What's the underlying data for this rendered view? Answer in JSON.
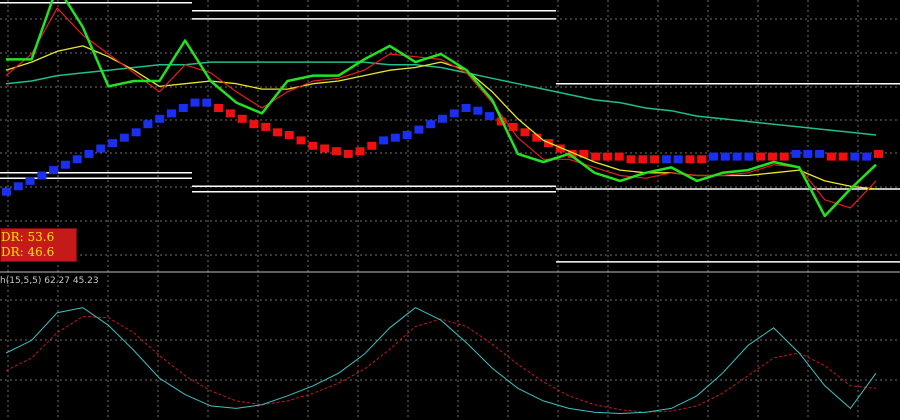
{
  "indicator_label": "h(15,5,5) 62.27 45.23",
  "dr_box": {
    "line1": "DR: 53.6",
    "line2": "DR: 46.6"
  },
  "colors": {
    "background": "#000000",
    "grid": "#6f6f6f",
    "fast_line": "#22e322",
    "signal_line": "#e51d1d",
    "ma_line": "#e8e829",
    "trend_line": "#1fbf88",
    "block_up": "#1a2ff2",
    "block_down": "#f20f0f",
    "level_line": "#ffffff",
    "osc_main": "#3ec2c2",
    "osc_signal": "#c41a1a",
    "separator": "#c0c0c0"
  },
  "chart_data": [
    {
      "type": "line",
      "panel": "price",
      "x_points": 35,
      "ylim": [
        0,
        1
      ],
      "series": [
        {
          "role": "fast",
          "values": [
            0.78,
            0.78,
            1.05,
            0.9,
            0.68,
            0.7,
            0.7,
            0.85,
            0.7,
            0.62,
            0.58,
            0.7,
            0.72,
            0.72,
            0.78,
            0.83,
            0.77,
            0.8,
            0.74,
            0.63,
            0.43,
            0.4,
            0.43,
            0.36,
            0.33,
            0.36,
            0.38,
            0.33,
            0.36,
            0.37,
            0.4,
            0.38,
            0.2,
            0.3,
            0.39
          ]
        },
        {
          "role": "signal",
          "values": [
            0.72,
            0.8,
            0.97,
            0.87,
            0.8,
            0.73,
            0.66,
            0.76,
            0.73,
            0.66,
            0.6,
            0.66,
            0.7,
            0.71,
            0.74,
            0.8,
            0.79,
            0.78,
            0.73,
            0.62,
            0.49,
            0.41,
            0.41,
            0.38,
            0.35,
            0.34,
            0.36,
            0.35,
            0.35,
            0.36,
            0.39,
            0.38,
            0.26,
            0.23,
            0.33
          ]
        },
        {
          "role": "ma",
          "values": [
            0.74,
            0.77,
            0.81,
            0.83,
            0.79,
            0.74,
            0.68,
            0.69,
            0.7,
            0.69,
            0.67,
            0.67,
            0.69,
            0.7,
            0.72,
            0.74,
            0.75,
            0.77,
            0.74,
            0.66,
            0.56,
            0.48,
            0.44,
            0.4,
            0.37,
            0.36,
            0.36,
            0.35,
            0.35,
            0.35,
            0.36,
            0.37,
            0.33,
            0.31,
            0.3
          ]
        },
        {
          "role": "trend",
          "values": [
            0.69,
            0.7,
            0.72,
            0.73,
            0.74,
            0.75,
            0.76,
            0.76,
            0.77,
            0.77,
            0.77,
            0.77,
            0.77,
            0.77,
            0.77,
            0.76,
            0.76,
            0.75,
            0.73,
            0.71,
            0.69,
            0.67,
            0.65,
            0.63,
            0.62,
            0.6,
            0.59,
            0.57,
            0.56,
            0.55,
            0.54,
            0.53,
            0.52,
            0.51,
            0.5
          ]
        }
      ],
      "blocks": {
        "values": [
          0.29,
          0.31,
          0.33,
          0.35,
          0.37,
          0.39,
          0.41,
          0.43,
          0.45,
          0.47,
          0.49,
          0.51,
          0.54,
          0.56,
          0.58,
          0.6,
          0.62,
          0.62,
          0.6,
          0.58,
          0.56,
          0.54,
          0.53,
          0.51,
          0.5,
          0.48,
          0.46,
          0.45,
          0.44,
          0.43,
          0.44,
          0.46,
          0.48,
          0.49,
          0.5,
          0.52,
          0.54,
          0.56,
          0.58,
          0.6,
          0.59,
          0.57,
          0.55,
          0.53,
          0.51,
          0.49,
          0.47,
          0.45,
          0.43,
          0.43,
          0.42,
          0.42,
          0.42,
          0.41,
          0.41,
          0.41,
          0.41,
          0.41,
          0.41,
          0.41,
          0.42,
          0.42,
          0.42,
          0.42,
          0.42,
          0.42,
          0.42,
          0.43,
          0.43,
          0.43,
          0.42,
          0.42,
          0.42,
          0.42,
          0.43
        ],
        "dirs": "UUUUUUUUUUUUUUUUUUDDDDDDDDDDDDDDUUUUUUUUUUDDDDDDDDDDDDDDUUDDUUUUDDDUUUDDUU"
      },
      "levels": [
        0.99,
        0.96,
        0.93,
        0.36,
        0.34,
        0.31,
        0.29,
        0.69,
        0.3,
        0.03
      ]
    },
    {
      "type": "line",
      "panel": "oscillator",
      "x_points": 35,
      "ylim": [
        0,
        100
      ],
      "series": [
        {
          "role": "main",
          "values": [
            50,
            60,
            82,
            86,
            72,
            52,
            30,
            17,
            8,
            6,
            9,
            16,
            24,
            34,
            49,
            70,
            86,
            76,
            58,
            38,
            22,
            12,
            6,
            3,
            2,
            3,
            6,
            16,
            34,
            56,
            70,
            50,
            24,
            6,
            34
          ]
        },
        {
          "role": "signal",
          "values": [
            36,
            46,
            66,
            79,
            78,
            66,
            48,
            32,
            20,
            12,
            9,
            12,
            18,
            26,
            37,
            53,
            71,
            77,
            71,
            57,
            41,
            27,
            16,
            9,
            5,
            3,
            4,
            8,
            18,
            32,
            46,
            50,
            40,
            24,
            22
          ]
        }
      ]
    }
  ]
}
